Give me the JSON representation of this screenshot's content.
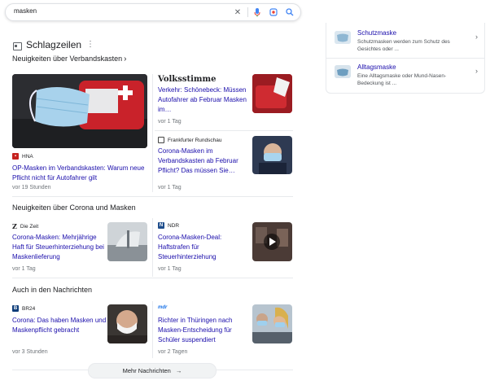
{
  "search": {
    "query": "masken"
  },
  "headlines": {
    "title": "Schlagzeilen",
    "subtitle": "Neuigkeiten über Verbandskasten",
    "lead": {
      "source": "HNA",
      "headline": "OP-Masken im Verbandskasten: Warum neue Pflicht nicht für Autofahrer gilt",
      "time": "vor 19 Stunden"
    },
    "right_items": [
      {
        "source": "Volksstimme",
        "headline": "Verkehr: Schönebeck: Müssen Autofahrer ab Februar Masken im…",
        "time": "vor 1 Tag"
      },
      {
        "source": "Frankfurter Rundschau",
        "headline": "Corona-Masken im Verbandskasten ab Februar Pflicht? Das müssen Sie…",
        "time": "vor 1 Tag"
      }
    ]
  },
  "corona_section": {
    "title": "Neuigkeiten über Corona und Masken",
    "items": [
      {
        "source": "Die Zeit",
        "logo": "Z",
        "headline": "Corona-Masken: Mehrjährige Haft für Steuerhinterziehung bei Maskenlieferung",
        "time": "vor 1 Tag"
      },
      {
        "source": "NDR",
        "logo": "N",
        "headline": "Corona-Masken-Deal: Haftstrafen für Steuerhinterziehung",
        "time": "vor 1 Tag"
      }
    ]
  },
  "news_section": {
    "title": "Auch in den Nachrichten",
    "items": [
      {
        "source": "BR24",
        "logo": "B",
        "headline": "Corona: Das haben Masken und Maskenpflicht gebracht",
        "time": "vor 3 Stunden"
      },
      {
        "source": "mdr",
        "logo": "mdr",
        "headline": "Richter in Thüringen nach Masken-Entscheidung für Schüler suspendiert",
        "time": "vor 2 Tagen"
      }
    ]
  },
  "more_button": {
    "label": "Mehr Nachrichten"
  },
  "side_panel": {
    "items": [
      {
        "title": "Schutzmaske",
        "desc": "Schutzmasken werden zum Schutz des Gesichtes oder ..."
      },
      {
        "title": "Alltagsmaske",
        "desc": "Eine Alltagsmaske oder Mund-Nasen-Bedeckung ist ..."
      }
    ]
  },
  "colors": {
    "link": "#1a0dab",
    "meta": "#70757a",
    "hna": "#c5221f",
    "google_blue": "#4285f4"
  }
}
